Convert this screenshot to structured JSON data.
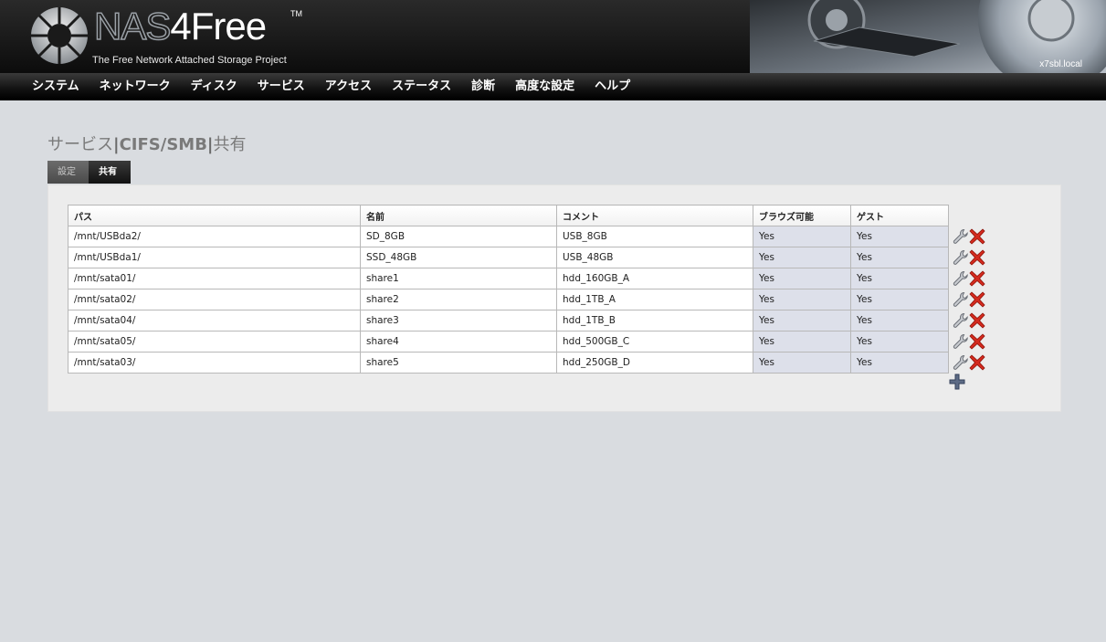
{
  "header": {
    "logo_main": "NAS",
    "logo_accent": "4Free",
    "trademark": "TM",
    "tagline": "The Free Network Attached Storage Project",
    "hostname": "x7sbl.local"
  },
  "nav": {
    "items": [
      "システム",
      "ネットワーク",
      "ディスク",
      "サービス",
      "アクセス",
      "ステータス",
      "診断",
      "高度な設定",
      "ヘルプ"
    ]
  },
  "breadcrumb": {
    "part1": "サービス",
    "sep": "|",
    "part2": "CIFS/SMB",
    "part3": "共有"
  },
  "tabs": [
    {
      "label": "設定",
      "active": false
    },
    {
      "label": "共有",
      "active": true
    }
  ],
  "table": {
    "headers": [
      "パス",
      "名前",
      "コメント",
      "ブラウズ可能",
      "ゲスト"
    ],
    "rows": [
      {
        "path": "/mnt/USBda2/",
        "name": "SD_8GB",
        "comment": "USB_8GB",
        "browseable": "Yes",
        "guest": "Yes"
      },
      {
        "path": "/mnt/USBda1/",
        "name": "SSD_48GB",
        "comment": "USB_48GB",
        "browseable": "Yes",
        "guest": "Yes"
      },
      {
        "path": "/mnt/sata01/",
        "name": "share1",
        "comment": "hdd_160GB_A",
        "browseable": "Yes",
        "guest": "Yes"
      },
      {
        "path": "/mnt/sata02/",
        "name": "share2",
        "comment": "hdd_1TB_A",
        "browseable": "Yes",
        "guest": "Yes"
      },
      {
        "path": "/mnt/sata04/",
        "name": "share3",
        "comment": "hdd_1TB_B",
        "browseable": "Yes",
        "guest": "Yes"
      },
      {
        "path": "/mnt/sata05/",
        "name": "share4",
        "comment": "hdd_500GB_C",
        "browseable": "Yes",
        "guest": "Yes"
      },
      {
        "path": "/mnt/sata03/",
        "name": "share5",
        "comment": "hdd_250GB_D",
        "browseable": "Yes",
        "guest": "Yes"
      }
    ]
  },
  "icons": {
    "edit": "wrench-icon",
    "delete": "delete-x-icon",
    "add": "plus-icon"
  },
  "colors": {
    "background": "#d9dce0",
    "panel": "#ececec",
    "shaded_cell": "#dde0ea",
    "delete_red": "#d32a1e"
  }
}
